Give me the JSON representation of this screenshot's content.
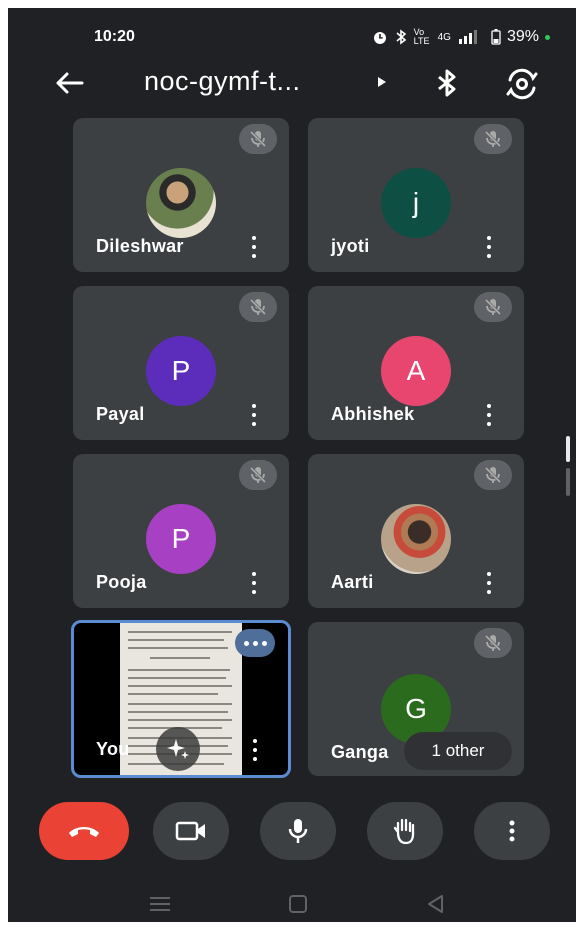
{
  "status_bar": {
    "time": "10:20",
    "battery": "39%",
    "icons": [
      "alarm-icon",
      "bluetooth-icon",
      "volte-icon",
      "4g-icon",
      "signal-icon",
      "battery-icon"
    ],
    "volte_label": "Vo LTE",
    "network_label": "4G"
  },
  "header": {
    "title": "noc-gymf-t...",
    "icons": [
      "back-arrow-icon",
      "bluetooth-icon",
      "switch-camera-icon"
    ]
  },
  "participants": [
    {
      "name": "Dileshwar",
      "avatar_type": "photo",
      "muted": true
    },
    {
      "name": "jyoti",
      "avatar_letter": "j",
      "avatar_color": "#0d4f43",
      "muted": true
    },
    {
      "name": "Payal",
      "avatar_letter": "P",
      "avatar_color": "#5b2dba",
      "muted": true
    },
    {
      "name": "Abhishek",
      "avatar_letter": "A",
      "avatar_color": "#e8466f",
      "muted": true
    },
    {
      "name": "Pooja",
      "avatar_letter": "P",
      "avatar_color": "#a840c4",
      "muted": true
    },
    {
      "name": "Aarti",
      "avatar_type": "photo",
      "muted": true
    },
    {
      "name": "You",
      "self_view": true
    },
    {
      "name": "Ganga",
      "avatar_letter": "G",
      "avatar_color": "#2b6b1e",
      "muted": true,
      "overflow_label": "1 other"
    }
  ],
  "controls": [
    "end-call-icon",
    "camera-icon",
    "microphone-icon",
    "raise-hand-icon",
    "more-options-icon"
  ],
  "colors": {
    "background": "#202124",
    "tile": "#3c4043",
    "end_call": "#ea4335",
    "self_border": "#5b8bd1"
  }
}
